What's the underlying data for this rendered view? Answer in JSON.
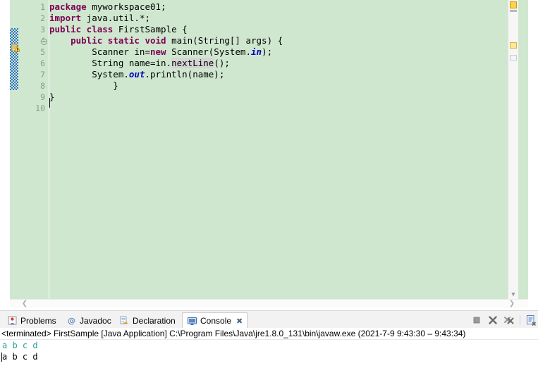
{
  "editor": {
    "language": "java",
    "background_color": "#cfe7cf",
    "current_line_color": "#e4edf7",
    "keyword_color": "#7f0055",
    "static_field_color": "#0000c0",
    "line_numbers": [
      "1",
      "2",
      "3",
      "4",
      "5",
      "6",
      "7",
      "8",
      "9",
      "10"
    ],
    "lines": [
      {
        "n": "1",
        "text": "package myworkspace01;"
      },
      {
        "n": "2",
        "text": "import java.util.*;"
      },
      {
        "n": "3",
        "text": "public class FirstSample {"
      },
      {
        "n": "4",
        "text": "    public static void main(String[] args) {"
      },
      {
        "n": "5",
        "text": "        Scanner in=new Scanner(System.in);"
      },
      {
        "n": "6",
        "text": "        String name=in.nextLine();"
      },
      {
        "n": "7",
        "text": "        System.out.println(name);"
      },
      {
        "n": "8",
        "text": "            }"
      },
      {
        "n": "9",
        "text": "}"
      },
      {
        "n": "10",
        "text": ""
      }
    ],
    "tokens": {
      "package": "package",
      "import": "import",
      "public": "public",
      "class": "class",
      "static": "static",
      "void": "void",
      "new": "new",
      "field_in": "in",
      "field_out": "out"
    },
    "markers": {
      "warning_icon": "warning-icon",
      "fold_collapse_icon": "fold-collapse-icon",
      "change_bar": "changed-lines-bar"
    },
    "scroll": {
      "up_arrow": "▲",
      "down_arrow": "▼",
      "left_arrow": "❮",
      "right_arrow": "❯"
    }
  },
  "bottom_panel": {
    "tabs": [
      {
        "label": "Problems",
        "icon": "problems-icon",
        "active": false,
        "closable": false
      },
      {
        "label": "Javadoc",
        "icon": "javadoc-icon",
        "active": false,
        "closable": false
      },
      {
        "label": "Declaration",
        "icon": "declaration-icon",
        "active": false,
        "closable": false
      },
      {
        "label": "Console",
        "icon": "console-icon",
        "active": true,
        "closable": true
      }
    ],
    "close_glyph": "✖",
    "toolbar": [
      {
        "name": "terminate-button",
        "icon": "stop-square-icon"
      },
      {
        "name": "remove-console-button",
        "icon": "x-icon"
      },
      {
        "name": "remove-all-consoles-button",
        "icon": "double-x-icon"
      },
      {
        "name": "open-console-button",
        "icon": "new-console-icon"
      }
    ],
    "status_line": "<terminated> FirstSample [Java Application] C:\\Program Files\\Java\\jre1.8.0_131\\bin\\javaw.exe  (2021-7-9 9:43:30 – 9:43:34)",
    "console": {
      "input_echo_line": "a b c d",
      "output_line": "a b c d",
      "input_color": "#2aa198",
      "output_color": "#000000"
    }
  }
}
